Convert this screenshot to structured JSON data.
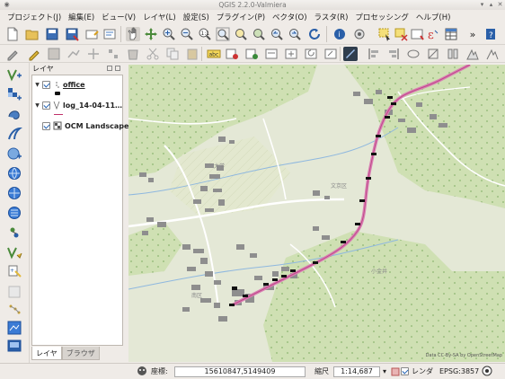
{
  "window": {
    "title": "QGIS 2.2.0-Valmiera"
  },
  "menu": [
    "プロジェクト(J)",
    "編集(E)",
    "ビュー(V)",
    "レイヤ(L)",
    "設定(S)",
    "プラグイン(P)",
    "ベクタ(O)",
    "ラスタ(R)",
    "プロセッシング",
    "ヘルプ(H)"
  ],
  "toolbar": {
    "overflow_label": "»"
  },
  "layers_panel": {
    "title": "レイヤ",
    "layers": [
      {
        "name": "office",
        "expanded": true,
        "checked": true
      },
      {
        "name": "log_14-04-11…",
        "expanded": true,
        "checked": true
      },
      {
        "name": "OCM Landscape",
        "expanded": false,
        "checked": true
      }
    ],
    "tabs": [
      {
        "label": "レイヤ",
        "active": true
      },
      {
        "label": "ブラウザ",
        "active": false
      }
    ]
  },
  "map": {
    "attribution": "Data CC-By-SA by OpenStreetMap",
    "town_labels": [
      "文京区",
      "大学",
      "小金井",
      "南区"
    ]
  },
  "statusbar": {
    "coord_label": "座標:",
    "coord_value": "15610847,5149409",
    "scale_label": "縮尺",
    "scale_value": "1:14,687",
    "render_label": "レンダ",
    "epsg": "EPSG:3857"
  },
  "colors": {
    "map_base": "#e4e8d6",
    "forest": "#cfe0b3",
    "road_pink": "#d980b3",
    "building": "#8e8e8e",
    "accent": "#1d5fb2"
  }
}
